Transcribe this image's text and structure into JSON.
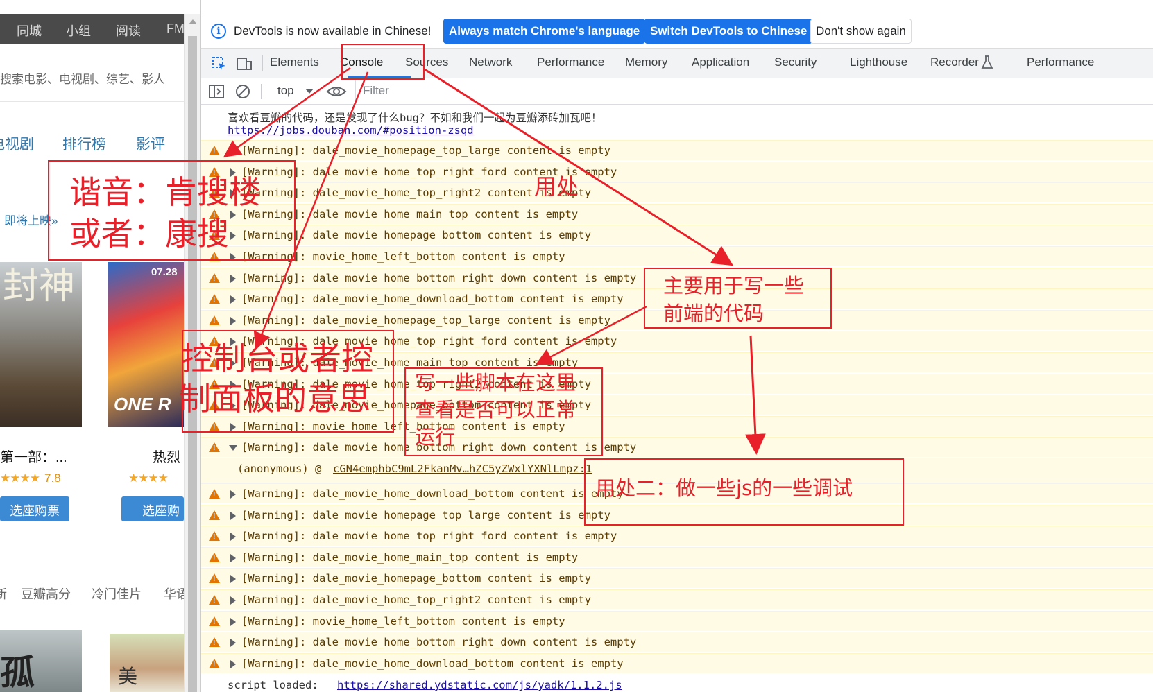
{
  "left_page": {
    "nav": [
      "同城",
      "小组",
      "阅读",
      "FM"
    ],
    "search_placeholder": "搜索电影、电视剧、综艺、影人",
    "tabs": [
      "电视剧",
      "排行榜",
      "影评"
    ],
    "coming_link": "即将上映»",
    "poster1_title": "封神",
    "poster2_title": "ONE R",
    "poster2_date": "07.28",
    "movie1_title": "第一部：...",
    "movie1_stars": "★★★★",
    "movie1_rating": "7.8",
    "movie2_title": "热烈",
    "movie2_stars": "★★★★",
    "buy_label": "选座购票",
    "categories": [
      "新",
      "豆瓣高分",
      "冷门佳片",
      "华语"
    ],
    "poster3_title": "孤",
    "poster4_title": "美"
  },
  "infobar": {
    "text": "DevTools is now available in Chinese!",
    "btn_match": "Always match Chrome's language",
    "btn_switch": "Switch DevTools to Chinese",
    "btn_dismiss": "Don't show again"
  },
  "tabs": {
    "elements": "Elements",
    "console": "Console",
    "sources": "Sources",
    "network": "Network",
    "performance": "Performance",
    "memory": "Memory",
    "application": "Application",
    "security": "Security",
    "lighthouse": "Lighthouse",
    "recorder": "Recorder",
    "performance_insights": "Performance"
  },
  "console_toolbar": {
    "context": "top",
    "filter_placeholder": "Filter"
  },
  "console": {
    "intro": "喜欢看豆瓣的代码，还是发现了什么bug？不如和我们一起为豆瓣添砖加瓦吧！",
    "intro_link": "https://jobs.douban.com/#position-zsqd",
    "warnings_a": [
      "[Warning]: dale_movie_homepage_top_large content is empty",
      "[Warning]: dale_movie_home_top_right_ford content is empty",
      "[Warning]: dale_movie_home_top_right2 content is empty",
      "[Warning]: dale_movie_home_main_top content is empty",
      "[Warning]: dale_movie_homepage_bottom content is empty",
      "[Warning]: movie_home_left_bottom content is empty",
      "[Warning]: dale_movie_home_bottom_right_down content is empty",
      "[Warning]: dale_movie_home_download_bottom content is empty",
      "[Warning]: dale_movie_homepage_top_large content is empty",
      "[Warning]: dale_movie_home_top_right_ford content is empty",
      "[Warning]: dale_movie_home_main_top content is empty",
      "[Warning]: dale_movie_home_top_right2 content is empty",
      "[Warning]: dale_movie_homepage_bottom content is empty",
      "[Warning]: movie_home_left_bottom content is empty",
      "[Warning]: dale_movie_home_bottom_right_down content is empty"
    ],
    "stack_prefix": "(anonymous) @ ",
    "stack_link": "cGN4emphbC9mL2FkanMv…hZC5yZWxlYXNlLmpz:1",
    "warnings_b": [
      "[Warning]: dale_movie_home_download_bottom content is empty",
      "[Warning]: dale_movie_homepage_top_large content is empty",
      "[Warning]: dale_movie_home_top_right_ford content is empty",
      "[Warning]: dale_movie_home_main_top content is empty",
      "[Warning]: dale_movie_homepage_bottom content is empty",
      "[Warning]: dale_movie_home_top_right2 content is empty",
      "[Warning]: movie_home_left_bottom content is empty",
      "[Warning]: dale_movie_home_bottom_right_down content is empty",
      "[Warning]: dale_movie_home_download_bottom content is empty"
    ],
    "script_loaded": "script loaded:",
    "script_link": "https://shared.ydstatic.com/js/yadk/1.1.2.js"
  },
  "annotations": {
    "pronunciation_1": "谐音：肯搜楼",
    "pronunciation_2": "或者：康搜",
    "usage_label": "用处",
    "meaning_1": "控制台或者控",
    "meaning_2": "制面板的意思",
    "purpose_1": "主要用于写一些",
    "purpose_2": "前端的代码",
    "script_1": "写一些脚本在这里",
    "script_2": "查看是否可以正常",
    "script_3": "运行",
    "usage_two": "用处二：做一些js的一些调试"
  },
  "colors": {
    "annotation_red": "#e8202a",
    "primary_blue": "#1a73e8",
    "warning_bg": "#fffbe5",
    "warning_icon": "#e37400"
  }
}
